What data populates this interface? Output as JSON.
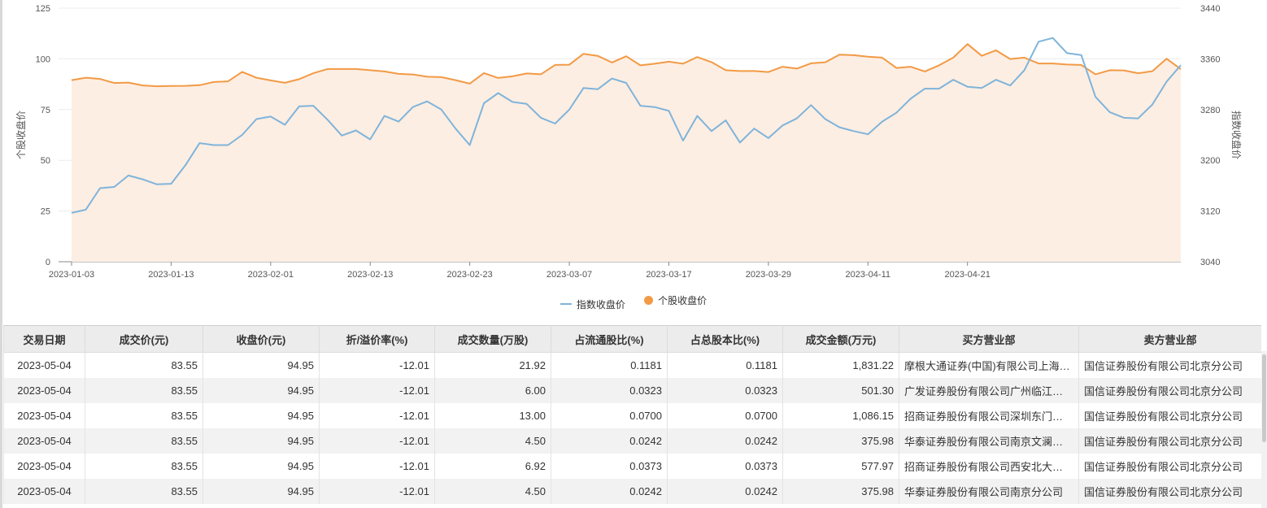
{
  "legend": {
    "index_series": "指数收盘价",
    "stock_series": "个股收盘价"
  },
  "colors": {
    "index_line": "#7fb4da",
    "stock_line": "#f29a45",
    "area_fill": "#fdeee3",
    "grid": "#ececec",
    "axis_text": "#555555"
  },
  "chart_data": {
    "type": "line",
    "ylabel_left": "个股收盘价",
    "ylabel_right": "指数收盘价",
    "ylim_left": [
      0,
      125
    ],
    "ylim_right": [
      3040,
      3440
    ],
    "yticks_left": [
      "0",
      "25",
      "50",
      "75",
      "100",
      "125"
    ],
    "yticks_right": [
      "3040",
      "3120",
      "3200",
      "3280",
      "3360",
      "3440"
    ],
    "grid": true,
    "legend_position": "bottom-center",
    "x_ticks": [
      "2023-01-03",
      "2023-01-13",
      "2023-02-01",
      "2023-02-13",
      "2023-02-23",
      "2023-03-07",
      "2023-03-17",
      "2023-03-29",
      "2023-04-11",
      "2023-04-21"
    ],
    "x_tick_indices": [
      0,
      7,
      14,
      21,
      28,
      35,
      42,
      49,
      56,
      63
    ],
    "series": [
      {
        "name": "指数收盘价",
        "axis": "right",
        "values": [
          3117,
          3122,
          3156,
          3158,
          3176,
          3170,
          3162,
          3163,
          3192,
          3227,
          3224,
          3224,
          3240,
          3265,
          3269,
          3256,
          3285,
          3286,
          3264,
          3239,
          3247,
          3233,
          3270,
          3261,
          3284,
          3293,
          3280,
          3250,
          3224,
          3290,
          3306,
          3292,
          3289,
          3267,
          3258,
          3280,
          3314,
          3312,
          3329,
          3322,
          3286,
          3284,
          3278,
          3231,
          3270,
          3246,
          3263,
          3228,
          3250,
          3235,
          3255,
          3266,
          3287,
          3265,
          3252,
          3246,
          3241,
          3261,
          3275,
          3297,
          3313,
          3313,
          3327,
          3316,
          3314,
          3327,
          3318,
          3342,
          3387,
          3393,
          3369,
          3366,
          3300,
          3276,
          3267,
          3266,
          3288,
          3324,
          3350
        ]
      },
      {
        "name": "个股收盘价",
        "axis": "left",
        "values": [
          89.5,
          90.7,
          90.1,
          88.1,
          88.3,
          86.9,
          86.5,
          86.6,
          86.7,
          87.0,
          88.6,
          88.9,
          93.6,
          90.7,
          89.4,
          88.2,
          90.0,
          92.9,
          95.0,
          95.0,
          95.0,
          94.4,
          93.8,
          92.6,
          92.3,
          91.2,
          91.0,
          89.5,
          87.8,
          93.0,
          90.6,
          91.4,
          92.8,
          92.4,
          97.0,
          97.1,
          102.5,
          101.5,
          98.2,
          101.3,
          96.8,
          97.6,
          98.6,
          97.6,
          100.9,
          98.4,
          94.4,
          94.0,
          94.0,
          93.5,
          96.1,
          95.2,
          97.8,
          98.3,
          102.1,
          101.8,
          101.1,
          100.6,
          95.5,
          96.1,
          93.8,
          96.8,
          100.6,
          107.3,
          101.5,
          104.2,
          99.9,
          100.6,
          97.7,
          97.7,
          97.2,
          97.0,
          92.4,
          94.4,
          94.3,
          92.9,
          93.9,
          100.1,
          94.9
        ]
      }
    ]
  },
  "table": {
    "headers": [
      "交易日期",
      "成交价(元)",
      "收盘价(元)",
      "折/溢价率(%)",
      "成交数量(万股)",
      "占流通股比(%)",
      "占总股本比(%)",
      "成交金额(万元)",
      "买方营业部",
      "卖方营业部"
    ],
    "rows": [
      [
        "2023-05-04",
        "83.55",
        "94.95",
        "-12.01",
        "21.92",
        "0.1181",
        "0.1181",
        "1,831.22",
        "摩根大通证券(中国)有限公司上海银城中路证券营业部",
        "国信证券股份有限公司北京分公司"
      ],
      [
        "2023-05-04",
        "83.55",
        "94.95",
        "-12.01",
        "6.00",
        "0.0323",
        "0.0323",
        "501.30",
        "广发证券股份有限公司广州临江大道证券营业部",
        "国信证券股份有限公司北京分公司"
      ],
      [
        "2023-05-04",
        "83.55",
        "94.95",
        "-12.01",
        "13.00",
        "0.0700",
        "0.0700",
        "1,086.15",
        "招商证券股份有限公司深圳东门南路证券营业部",
        "国信证券股份有限公司北京分公司"
      ],
      [
        "2023-05-04",
        "83.55",
        "94.95",
        "-12.01",
        "4.50",
        "0.0242",
        "0.0242",
        "375.98",
        "华泰证券股份有限公司南京文澜路证券营业部",
        "国信证券股份有限公司北京分公司"
      ],
      [
        "2023-05-04",
        "83.55",
        "94.95",
        "-12.01",
        "6.92",
        "0.0373",
        "0.0373",
        "577.97",
        "招商证券股份有限公司西安北大街证券营业部",
        "国信证券股份有限公司北京分公司"
      ],
      [
        "2023-05-04",
        "83.55",
        "94.95",
        "-12.01",
        "4.50",
        "0.0242",
        "0.0242",
        "375.98",
        "华泰证券股份有限公司南京分公司",
        "国信证券股份有限公司北京分公司"
      ]
    ]
  }
}
